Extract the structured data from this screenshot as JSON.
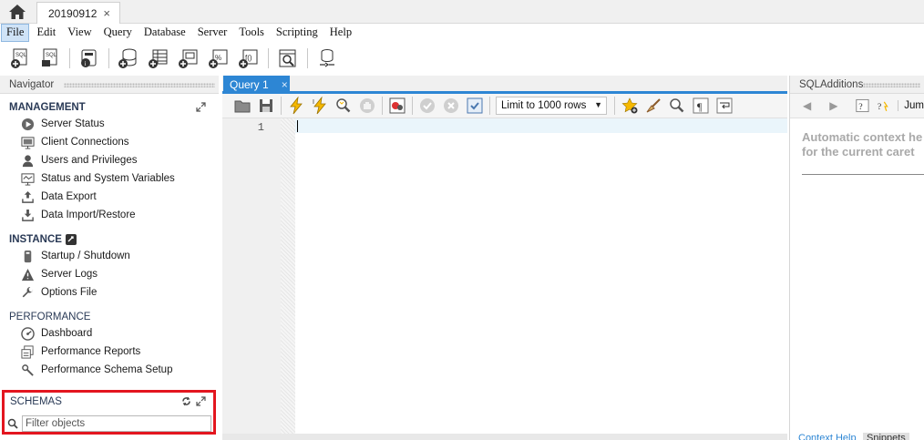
{
  "tabs": {
    "connection_tab": "20190912",
    "close_glyph": "×"
  },
  "menu": {
    "items": [
      "File",
      "Edit",
      "View",
      "Query",
      "Database",
      "Server",
      "Tools",
      "Scripting",
      "Help"
    ],
    "active": "File"
  },
  "navigator": {
    "title": "Navigator",
    "management": {
      "heading": "MANAGEMENT",
      "items": [
        "Server Status",
        "Client Connections",
        "Users and Privileges",
        "Status and System Variables",
        "Data Export",
        "Data Import/Restore"
      ]
    },
    "instance": {
      "heading": "INSTANCE",
      "items": [
        "Startup / Shutdown",
        "Server Logs",
        "Options File"
      ]
    },
    "performance": {
      "heading": "PERFORMANCE",
      "items": [
        "Dashboard",
        "Performance Reports",
        "Performance Schema Setup"
      ]
    },
    "schemas": {
      "heading": "SCHEMAS",
      "filter_placeholder": "Filter objects"
    }
  },
  "query": {
    "tab_label": "Query 1",
    "limit_label": "Limit to 1000 rows",
    "line_number": "1"
  },
  "sql_additions": {
    "title": "SQLAdditions",
    "jump_label": "Jum",
    "context_text_line1": "Automatic context he",
    "context_text_line2": "for the current caret",
    "tab_context_help": "Context Help",
    "tab_snippets": "Snippets"
  },
  "colors": {
    "accent": "#2d86d4",
    "highlight_border": "#e3161f",
    "section_heading": "#2a3a56"
  }
}
